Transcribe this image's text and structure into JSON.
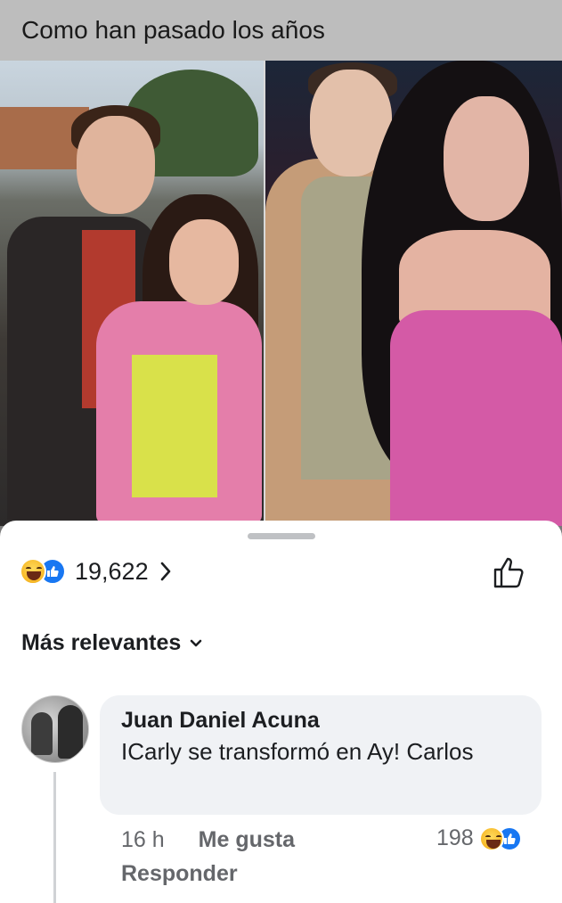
{
  "post": {
    "caption": "Como han pasado los años"
  },
  "reactions": {
    "count": "19,622",
    "types": [
      "haha-icon",
      "like-icon"
    ]
  },
  "sort": {
    "label": "Más relevantes"
  },
  "comment": {
    "author": "Juan Daniel Acuna",
    "text": "ICarly se transformó en Ay! Carlos",
    "time": "16 h",
    "like_label": "Me gusta",
    "reply_label": "Responder",
    "reaction_count": "198"
  },
  "colors": {
    "like_blue": "#1877f2",
    "bubble_bg": "#f0f2f5",
    "meta_gray": "#65676b"
  }
}
